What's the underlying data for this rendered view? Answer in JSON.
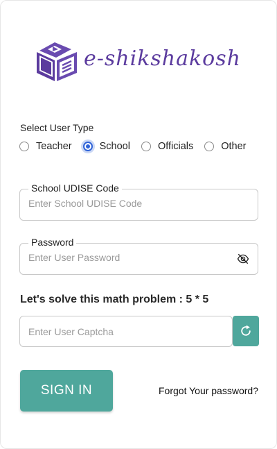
{
  "brand": {
    "logo_text": "e-shikshakosh",
    "accent_color": "#5b3b9e",
    "primary_color": "#4fa79c"
  },
  "user_type": {
    "label": "Select User Type",
    "options": [
      "Teacher",
      "School",
      "Officials",
      "Other"
    ],
    "selected": "School"
  },
  "udise": {
    "label": "School UDISE Code",
    "placeholder": "Enter School UDISE Code",
    "value": ""
  },
  "password": {
    "label": "Password",
    "placeholder": "Enter User Password",
    "value": "",
    "toggle_icon": "eye-slash-icon"
  },
  "captcha": {
    "prompt": "Let's solve this math problem : 5 * 5",
    "placeholder": "Enter User Captcha",
    "value": "",
    "refresh_icon": "refresh-icon"
  },
  "actions": {
    "sign_in_label": "SIGN IN",
    "forgot_label": "Forgot Your password?"
  }
}
